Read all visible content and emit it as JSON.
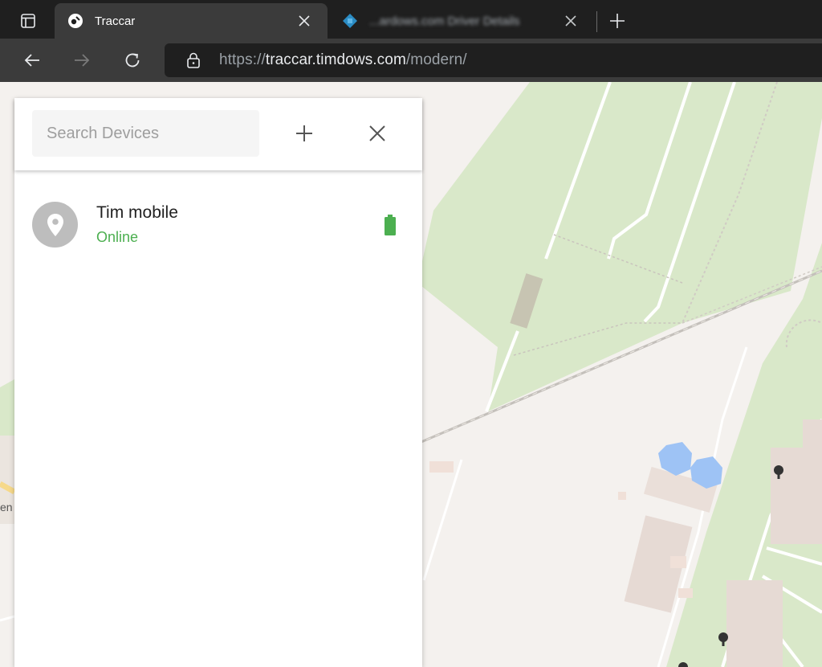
{
  "browser": {
    "tabs": [
      {
        "title": "Traccar",
        "active": true
      },
      {
        "title": "...ardows.com Driver Details"
      }
    ],
    "url": {
      "scheme": "https://",
      "host": "traccar.timdows.com",
      "path": "/modern/"
    }
  },
  "panel": {
    "search": {
      "placeholder": "Search Devices",
      "value": ""
    },
    "devices": [
      {
        "name": "Tim mobile",
        "status": "Online",
        "status_color": "#4caf50",
        "battery_color": "#4caf50"
      }
    ]
  },
  "map": {
    "labels": {
      "partial_street": "en"
    },
    "colors": {
      "background": "#f4f1ee",
      "park": "#d9e8c9",
      "water": "#9ec3f5",
      "building": "#e6dad4"
    }
  }
}
